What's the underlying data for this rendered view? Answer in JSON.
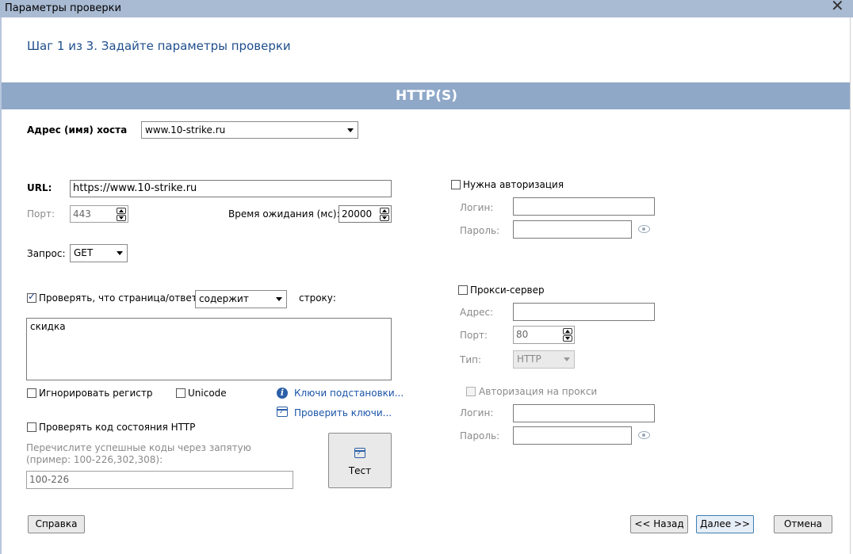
{
  "window": {
    "title": "Параметры проверки",
    "close_glyph": "✕"
  },
  "header": {
    "step_title": "Шаг 1 из 3. Задайте параметры проверки"
  },
  "section": {
    "title": "HTTP(S)"
  },
  "host": {
    "label": "Адрес (имя) хоста",
    "value": "www.10-strike.ru"
  },
  "url": {
    "label": "URL:",
    "value": "https://www.10-strike.ru"
  },
  "port": {
    "label": "Порт:",
    "value": "443"
  },
  "timeout": {
    "label": "Время ожидания (мс):",
    "value": "20000"
  },
  "request": {
    "label": "Запрос:",
    "value": "GET"
  },
  "content_check": {
    "checkbox_label": "Проверять, что страница/ответ",
    "checked": true,
    "condition_value": "содержит",
    "suffix_label": "строку:",
    "text": "скидка"
  },
  "options": {
    "ignore_case_label": "Игнорировать регистр",
    "unicode_label": "Unicode"
  },
  "links": {
    "substitution_keys": "Ключи подстановки...",
    "check_keys": "Проверить ключи..."
  },
  "http_status": {
    "checkbox_label": "Проверять код состояния HTTP",
    "hint_line1": "Перечислите успешные коды через запятую",
    "hint_line2": "(пример: 100-226,302,308):",
    "value": "100-226"
  },
  "test_button": {
    "label": "Тест"
  },
  "auth": {
    "checkbox_label": "Нужна авторизация",
    "login_label": "Логин:",
    "password_label": "Пароль:"
  },
  "proxy": {
    "checkbox_label": "Прокси-сервер",
    "address_label": "Адрес:",
    "port_label": "Порт:",
    "port_value": "80",
    "type_label": "Тип:",
    "type_value": "HTTP",
    "auth_checkbox_label": "Авторизация на прокси",
    "login_label": "Логин:",
    "password_label": "Пароль:"
  },
  "footer": {
    "help_label": "Справка",
    "back_label": "<< Назад",
    "next_label": "Далее >>",
    "cancel_label": "Отмена"
  },
  "colors": {
    "accent": "#1f4e8c",
    "section_bar": "#8fa8c8",
    "titlebar": "#a9bad3",
    "link": "#1a54a8"
  }
}
